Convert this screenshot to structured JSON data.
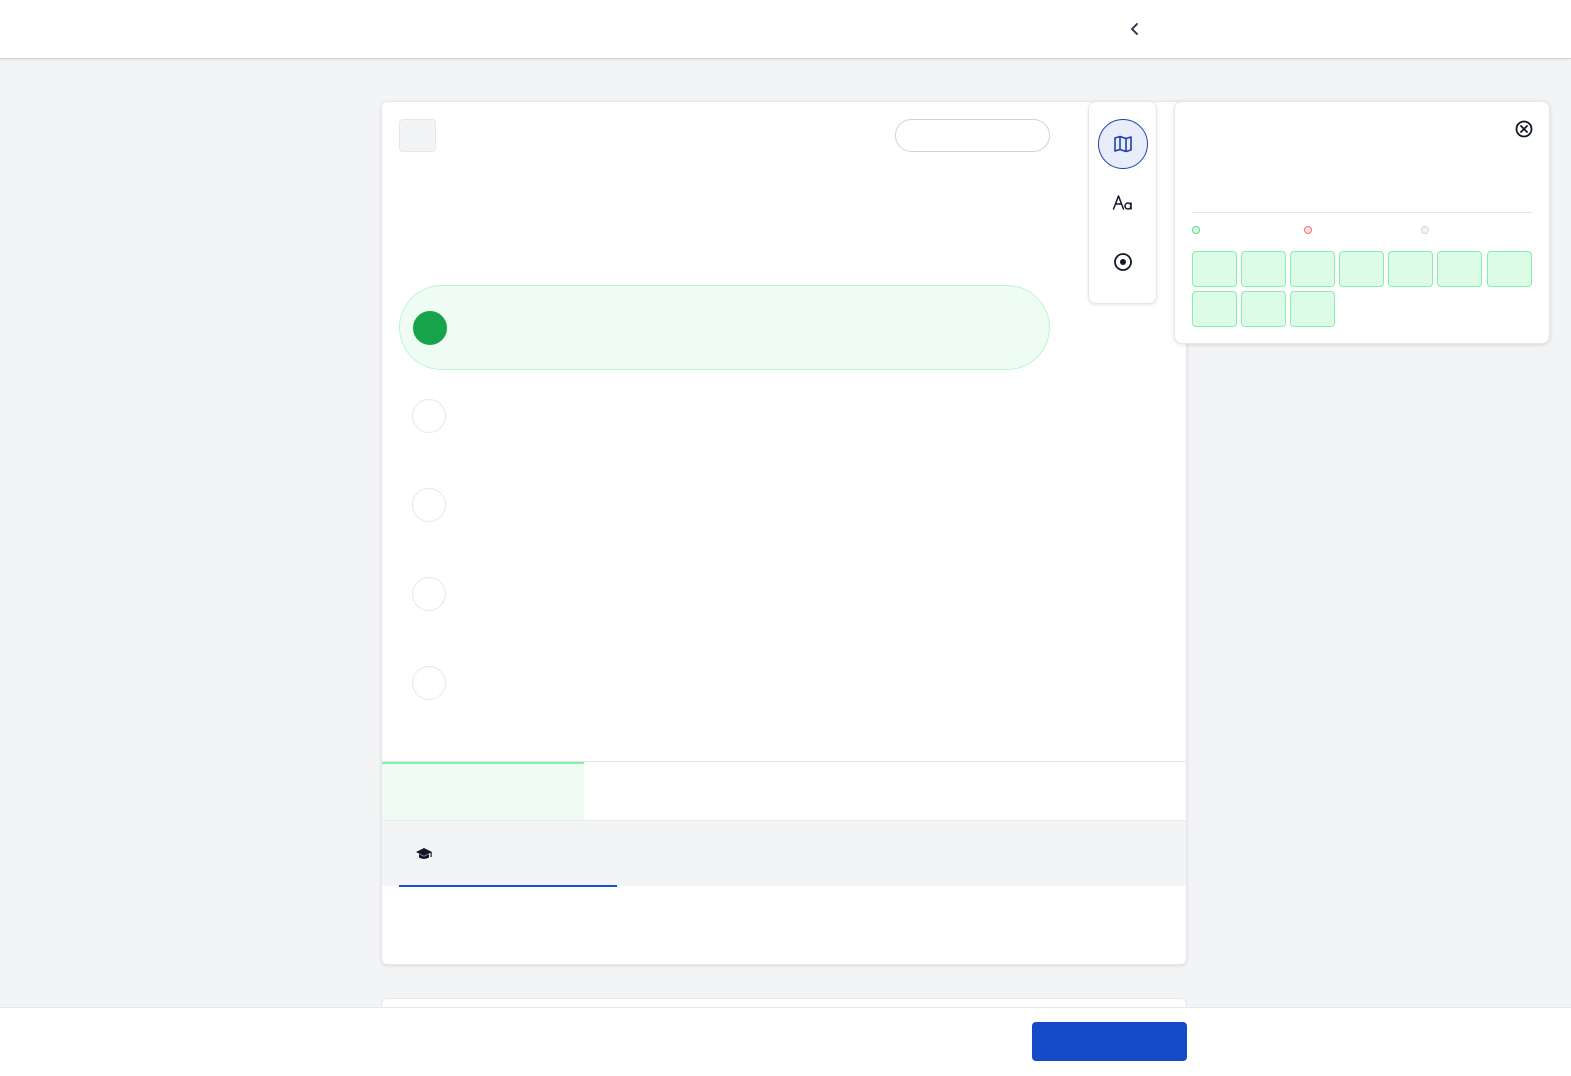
{
  "header": {
    "back_icon": "chevron-left-icon"
  },
  "question": {
    "number_label": "",
    "status_label": "",
    "stem": "",
    "options": [
      {
        "text": "",
        "selected": true
      },
      {
        "text": "",
        "selected": false
      },
      {
        "text": "",
        "selected": false
      },
      {
        "text": "",
        "selected": false
      },
      {
        "text": "",
        "selected": false
      }
    ],
    "result_label": "",
    "tabs": [
      {
        "label": "",
        "icon": "graduation-cap-icon"
      }
    ]
  },
  "toolbar": {
    "tools": [
      {
        "icon": "map-icon",
        "active": true
      },
      {
        "icon": "text-size-icon",
        "active": false
      },
      {
        "icon": "target-icon",
        "active": false
      }
    ]
  },
  "navigator_panel": {
    "close_icon": "close-circle-icon",
    "legend": [
      {
        "label": "",
        "color": "#86efac"
      },
      {
        "label": "",
        "color": "#fca5a5"
      },
      {
        "label": "",
        "color": "#d1d5db"
      }
    ],
    "cells": [
      "",
      "",
      "",
      "",
      "",
      "",
      "",
      "",
      "",
      ""
    ]
  },
  "footer": {
    "primary_button_label": ""
  },
  "colors": {
    "accent": "#1449c8",
    "correct": "#16a34a",
    "correct_bg": "#effcf3"
  }
}
